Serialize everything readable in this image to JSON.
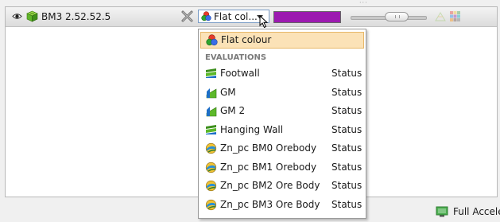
{
  "object_row": {
    "name": "BM3 2.52.52.5"
  },
  "colour_combo": {
    "selected": "Flat col..."
  },
  "colour_swatch": "#9c1ab0",
  "dropdown": {
    "first_item": "Flat colour",
    "section_label": "EVALUATIONS",
    "items": [
      {
        "label": "Footwall",
        "status": "Status",
        "icon": "evaluation-layer-icon"
      },
      {
        "label": "GM",
        "status": "Status",
        "icon": "evaluation-surface-icon"
      },
      {
        "label": "GM 2",
        "status": "Status",
        "icon": "evaluation-surface-icon"
      },
      {
        "label": "Hanging Wall",
        "status": "Status",
        "icon": "evaluation-layer-icon"
      },
      {
        "label": "Zn_pc BM0 Orebody",
        "status": "Status",
        "icon": "orebody-icon"
      },
      {
        "label": "Zn_pc BM1 Orebody",
        "status": "Status",
        "icon": "orebody-icon"
      },
      {
        "label": "Zn_pc BM2 Ore Body",
        "status": "Status",
        "icon": "orebody-icon"
      },
      {
        "label": "Zn_pc BM3 Ore Body",
        "status": "Status",
        "icon": "orebody-icon"
      }
    ]
  },
  "status_bar": {
    "text": "Full Accele"
  }
}
